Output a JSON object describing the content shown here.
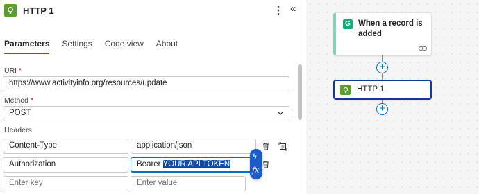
{
  "panel": {
    "title": "HTTP 1",
    "more_label": "⋮",
    "collapse_label": "«",
    "tabs": [
      {
        "label": "Parameters",
        "active": true
      },
      {
        "label": "Settings",
        "active": false
      },
      {
        "label": "Code view",
        "active": false
      },
      {
        "label": "About",
        "active": false
      }
    ],
    "uri": {
      "label": "URI",
      "required_mark": "*",
      "value": "https://www.activityinfo.org/resources/update"
    },
    "method": {
      "label": "Method",
      "required_mark": "*",
      "value": "POST"
    },
    "headers": {
      "label": "Headers",
      "rows": [
        {
          "key": "Content-Type",
          "value": "application/json"
        },
        {
          "key": "Authorization",
          "value_prefix": "Bearer ",
          "value_selected": "YOUR API TOKEN"
        }
      ],
      "key_placeholder": "Enter key",
      "value_placeholder": "Enter value"
    },
    "dynamic_content": {
      "bolt": "ϟ",
      "fx": "fx"
    }
  },
  "canvas": {
    "trigger": {
      "title": "When a record is added",
      "icon_letter": "G"
    },
    "action": {
      "title": "HTTP 1"
    },
    "add_label": "+"
  },
  "colors": {
    "accent": "#0f6cbd",
    "http_green": "#5a9e2f",
    "trigger_accent": "#86d2b6",
    "selection": "#0f4aa8"
  }
}
